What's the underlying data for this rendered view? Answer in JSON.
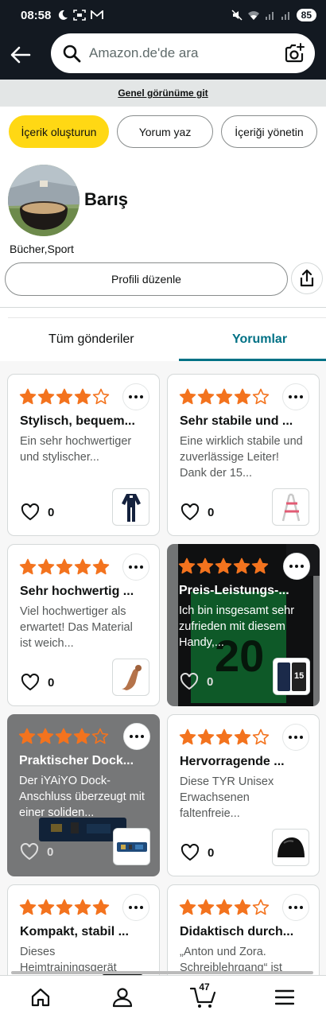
{
  "status_bar": {
    "time": "08:58",
    "battery": "85"
  },
  "search": {
    "placeholder": "Amazon.de'de ara"
  },
  "overview_link": "Genel görünüme git",
  "actions": {
    "create_content": "İçerik oluşturun",
    "write_review": "Yorum yaz",
    "manage_content": "İçeriği yönetin"
  },
  "profile": {
    "name": "Barış",
    "interests": "Bücher,Sport",
    "edit_button": "Profili düzenle"
  },
  "tabs": {
    "all_posts": "Tüm gönderiler",
    "reviews": "Yorumlar",
    "active": "reviews"
  },
  "reviews": [
    {
      "rating": 4,
      "title": "Stylisch, bequem...",
      "body": "Ein sehr hochwertiger und stylischer...",
      "likes": "0",
      "thumb_icon": "tracksuit-icon",
      "dark": false
    },
    {
      "rating": 4,
      "title": "Sehr stabile und ...",
      "body": "Eine wirklich stabile und zuverlässige Leiter! Dank der 15...",
      "likes": "0",
      "thumb_icon": "step-ladder-icon",
      "dark": false
    },
    {
      "rating": 5,
      "title": "Sehr hochwertig ...",
      "body": "Viel hochwertiger als erwartet! Das Material ist weich...",
      "likes": "0",
      "thumb_icon": "product-icon",
      "dark": false
    },
    {
      "rating": 5,
      "title": "Preis-Leistungs-...",
      "body": "Ich bin insgesamt sehr zufrieden mit diesem Handy,...",
      "likes": "0",
      "thumb_icon": "smartphone-box-icon",
      "dark": true,
      "photo": "phone-box-photo"
    },
    {
      "rating": 4,
      "title": "Praktischer Dock...",
      "body": "Der iYAiYO Dock-Anschluss überzeugt mit einer soliden...",
      "likes": "0",
      "thumb_icon": "circuit-board-icon",
      "dark": true,
      "photo": "circuit-board-photo"
    },
    {
      "rating": 4,
      "title": "Hervorragende ...",
      "body": "Diese TYR Unisex Erwachsenen faltenfreie...",
      "likes": "0",
      "thumb_icon": "swim-cap-icon",
      "dark": false
    },
    {
      "rating": 5,
      "title": "Kompakt, stabil ...",
      "body": "Dieses Heimtrainingsgerät",
      "likes": "",
      "thumb_icon": "",
      "dark": false
    },
    {
      "rating": 4,
      "title": "Didaktisch durch...",
      "body": "„Anton und Zora. Schreiblehrgang“ ist",
      "likes": "",
      "thumb_icon": "",
      "dark": false
    }
  ],
  "bottom_nav": {
    "cart_count": "47"
  },
  "colors": {
    "header": "#131921",
    "primary_button": "#ffd814",
    "star": "#f3731e",
    "tab_active": "#007185"
  }
}
